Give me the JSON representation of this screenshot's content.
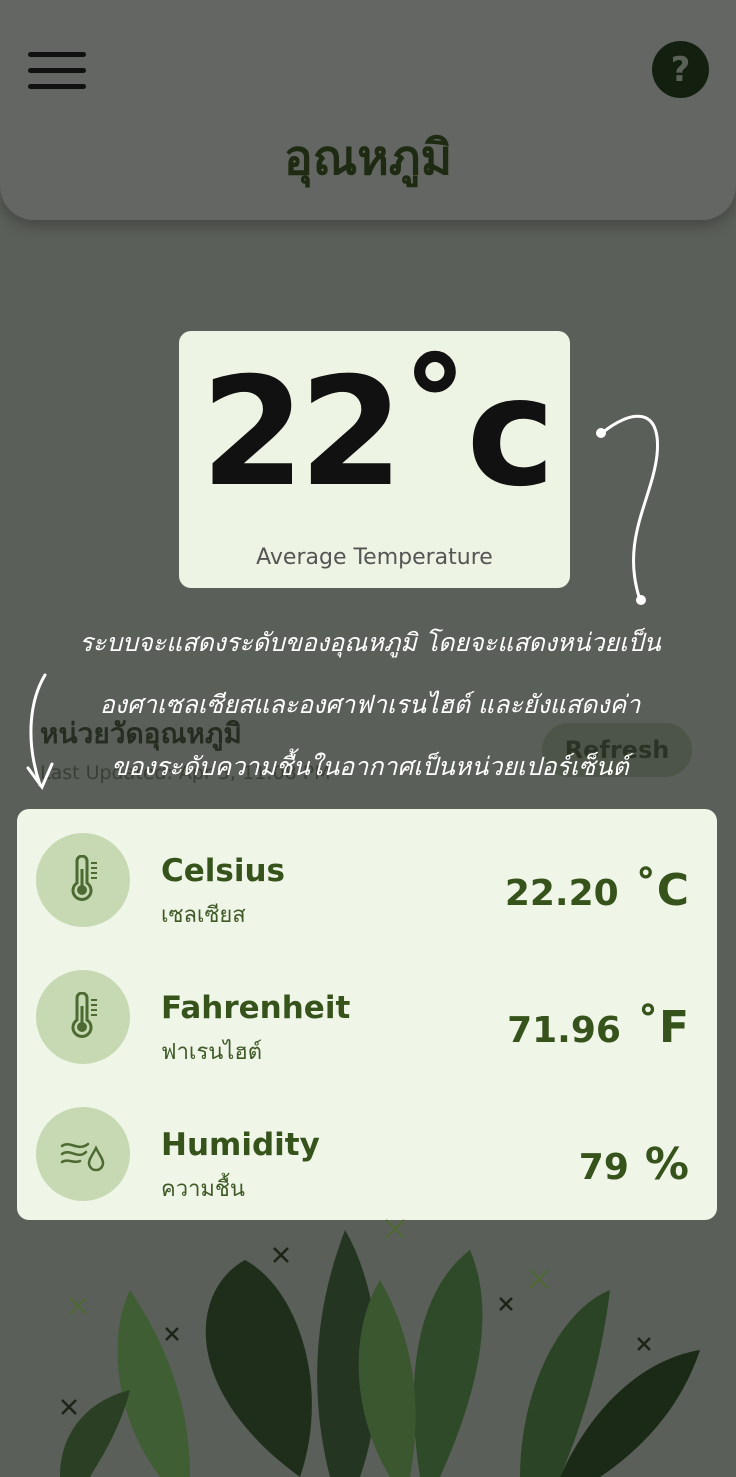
{
  "header": {
    "title": "อุณหภูมิ",
    "menu_icon": "hamburger-menu-icon",
    "help_label": "?"
  },
  "average": {
    "value": "22˚c",
    "label": "Average Temperature"
  },
  "annotation": {
    "lines": [
      "ระบบจะแสดงระดับของอุณหภูมิ โดยจะแสดงหน่วยเป็น",
      "องศาเซลเซียสและองศาฟาเรนไฮต์ และยังแสดงค่า",
      "ของระดับความชื้นในอากาศเป็นหน่วยเปอร์เซ็นต์"
    ]
  },
  "section": {
    "title": "หน่วยวัดอุณหภูมิ",
    "last_updated": "Last Updated: Apr 5, 11:08 PM",
    "refresh_label": "Refresh"
  },
  "readings": [
    {
      "name": "Celsius",
      "thai": "เซลเซียส",
      "value": "22.20",
      "unit": "˚C",
      "icon": "thermometer-icon"
    },
    {
      "name": "Fahrenheit",
      "thai": "ฟาเรนไฮต์",
      "value": "71.96",
      "unit": "˚F",
      "icon": "thermometer-icon"
    },
    {
      "name": "Humidity",
      "thai": "ความชื้น",
      "value": "79",
      "unit": "%",
      "icon": "humidity-icon"
    }
  ],
  "colors": {
    "background": "#5b5f59",
    "card": "#eef4e4",
    "accent_green": "#37531c",
    "icon_circle": "#c6d9b3"
  }
}
